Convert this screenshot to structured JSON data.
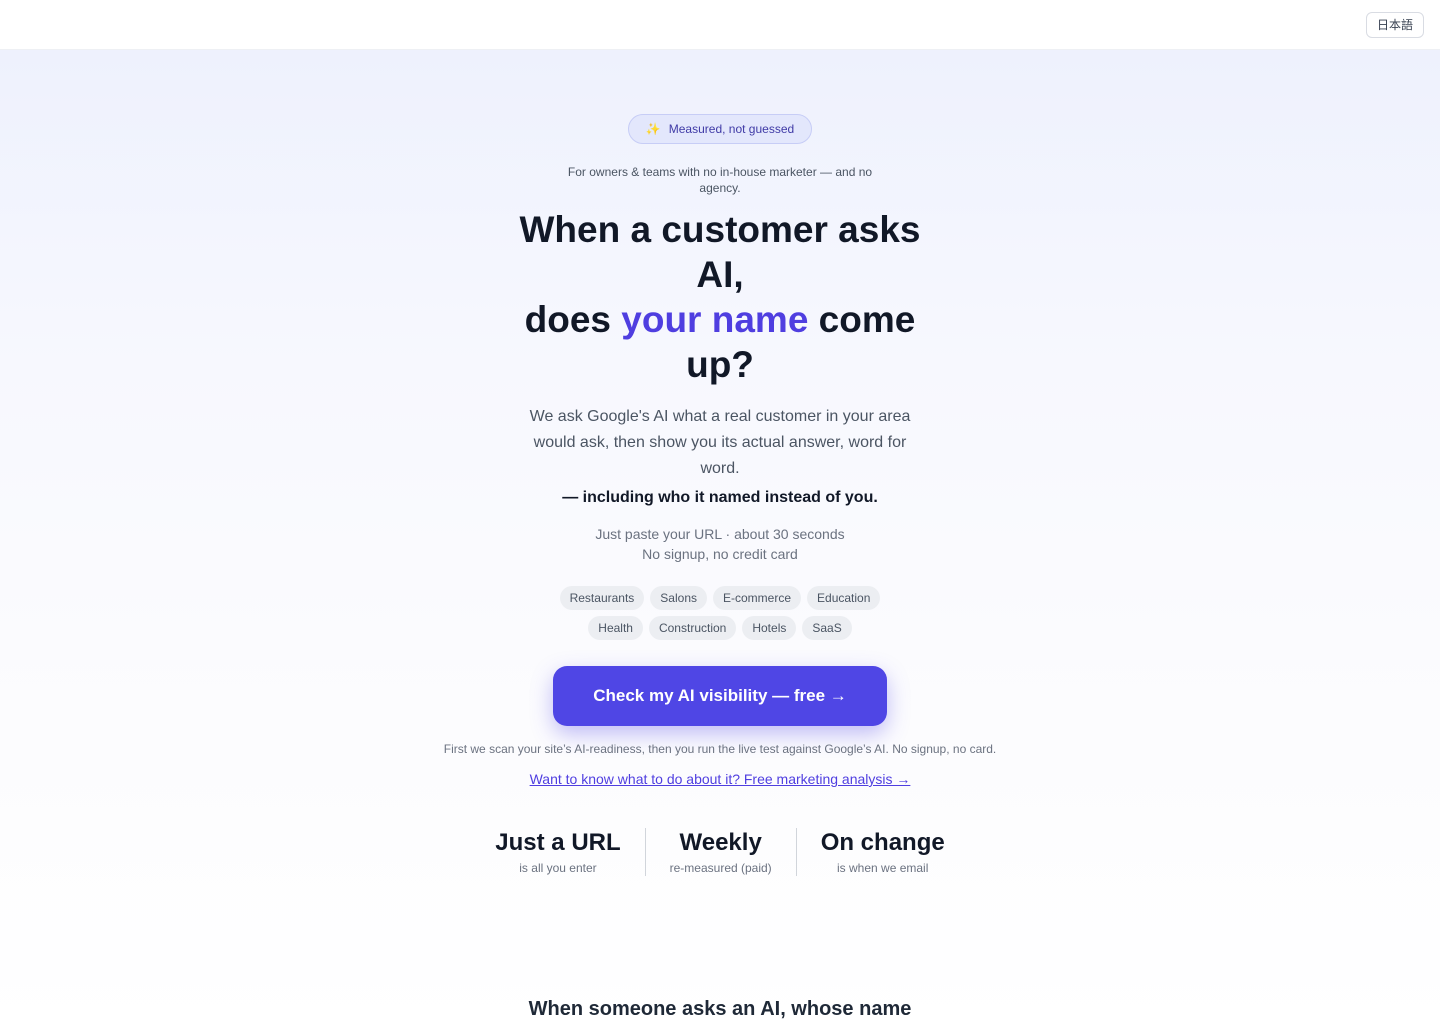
{
  "header": {
    "lang_button": "日本語"
  },
  "hero": {
    "badge_icon": "sparkles-icon",
    "badge": "Measured, not guessed",
    "audience": "For owners & teams with no in-house marketer — and no agency.",
    "headline_line1": "When a customer asks AI,",
    "headline_pre": "does ",
    "headline_accent": "your name",
    "headline_post": " come up?",
    "subhead": "We ask Google's AI what a real customer in your area would ask, then show you its actual answer, word for word.",
    "subhead_strong": "— including who it named instead of you.",
    "meta_line1": "Just paste your URL · about 30 seconds",
    "meta_line2": "No signup, no credit card",
    "chips_row1": [
      "Restaurants",
      "Salons",
      "E-commerce",
      "Education"
    ],
    "chips_row2": [
      "Health",
      "Construction",
      "Hotels",
      "SaaS"
    ],
    "cta": "Check my AI visibility — free →",
    "note": "First we scan your site’s AI-readiness, then you run the live test against Google’s AI. No signup, no card.",
    "link": "Want to know what to do about it? Free marketing analysis →",
    "accent_color": "#4f46e5"
  },
  "stats": [
    {
      "big": "Just a URL",
      "small": "is all you enter"
    },
    {
      "big": "Weekly",
      "small": "re-measured (paid)"
    },
    {
      "big": "On change",
      "small": "is when we email"
    }
  ],
  "section": {
    "title": "When someone asks an AI, whose name"
  }
}
